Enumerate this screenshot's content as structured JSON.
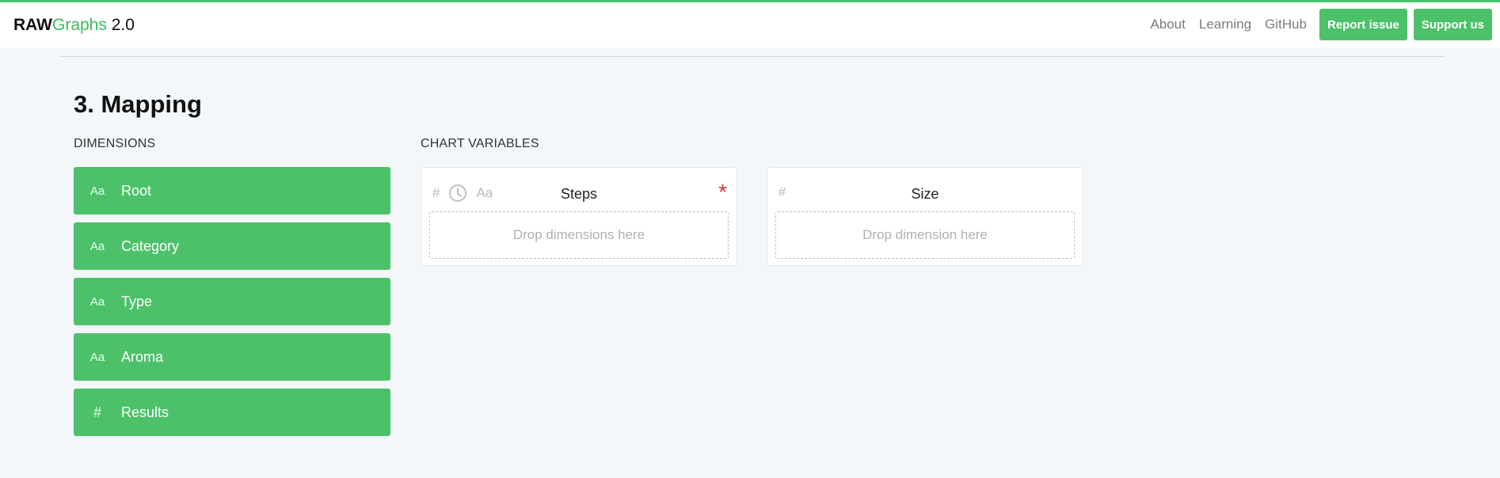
{
  "header": {
    "brand_raw": "RAW",
    "brand_graphs": "Graphs",
    "brand_version": "2.0",
    "nav_links": [
      "About",
      "Learning",
      "GitHub"
    ],
    "buttons": [
      "Report issue",
      "Support us"
    ]
  },
  "section": {
    "title": "3. Mapping"
  },
  "dimensions": {
    "label": "DIMENSIONS",
    "items": [
      {
        "type": "Aa",
        "label": "Root"
      },
      {
        "type": "Aa",
        "label": "Category"
      },
      {
        "type": "Aa",
        "label": "Type"
      },
      {
        "type": "Aa",
        "label": "Aroma"
      },
      {
        "type": "#",
        "label": "Results"
      }
    ]
  },
  "chart_variables": {
    "label": "CHART VARIABLES",
    "items": [
      {
        "name": "Steps",
        "types": [
          "#",
          "clock",
          "Aa"
        ],
        "required": "*",
        "drop": "Drop dimensions here"
      },
      {
        "name": "Size",
        "types": [
          "#"
        ],
        "required": "",
        "drop": "Drop dimension here"
      }
    ]
  },
  "colors": {
    "accent": "#4cc16a",
    "required": "#d3333a",
    "background": "#f3f7f9"
  }
}
